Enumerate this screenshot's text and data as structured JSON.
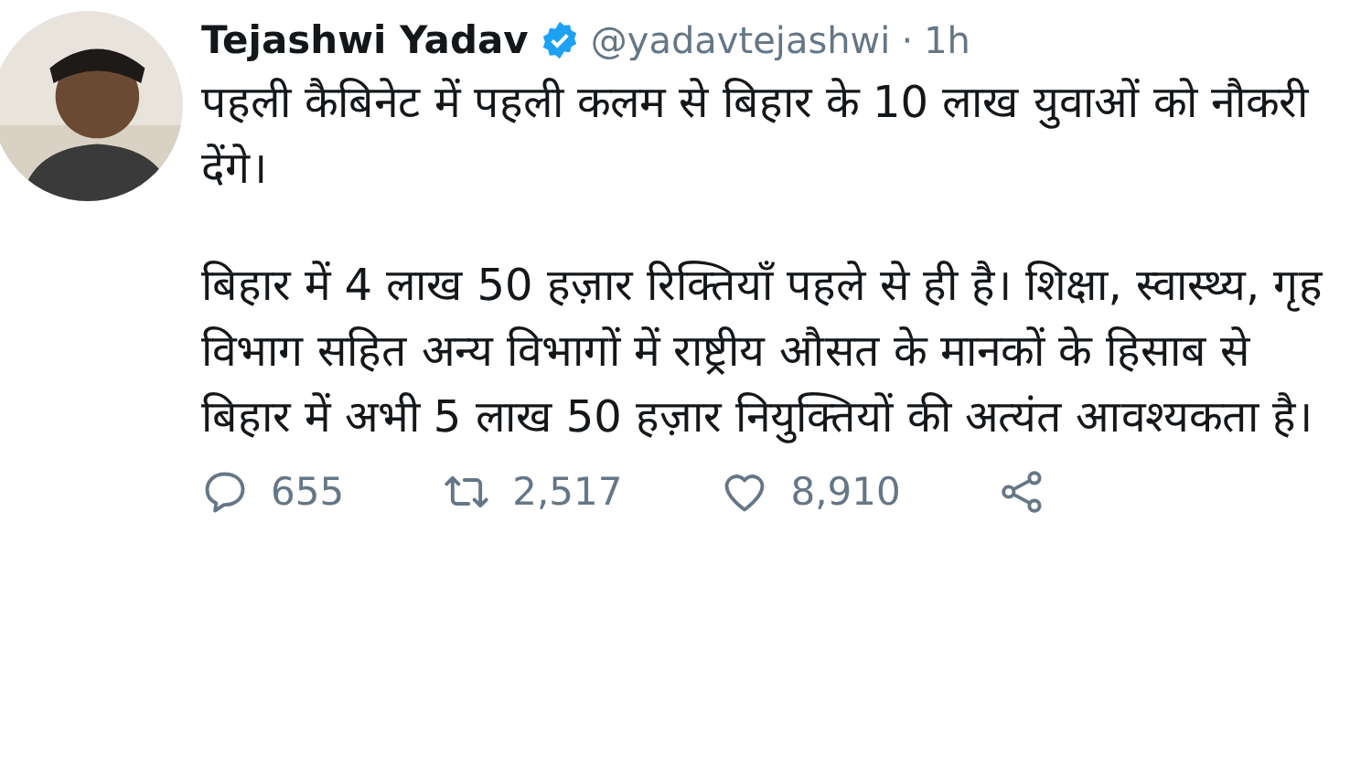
{
  "author": {
    "name": "Tejashwi Yadav",
    "verified": true,
    "handle": "@yadavtejashwi",
    "separator": "·",
    "time": "1h"
  },
  "paragraphs": [
    "पहली कैबिनेट में पहली कलम से बिहार के 10 लाख युवाओं को नौकरी देंगे।",
    "बिहार में 4 लाख 50 हज़ार रिक्तियाँ पहले से ही है। शिक्षा, स्वास्थ्य, गृह विभाग सहित अन्य विभागों में राष्ट्रीय औसत के मानकों के हिसाब से बिहार में अभी 5 लाख 50 हज़ार नियुक्तियों की अत्यंत आवश्यकता है।"
  ],
  "actions": [
    {
      "kind": "reply",
      "count": "655"
    },
    {
      "kind": "retweet",
      "count": "2,517"
    },
    {
      "kind": "like",
      "count": "8,910"
    },
    {
      "kind": "share"
    }
  ]
}
